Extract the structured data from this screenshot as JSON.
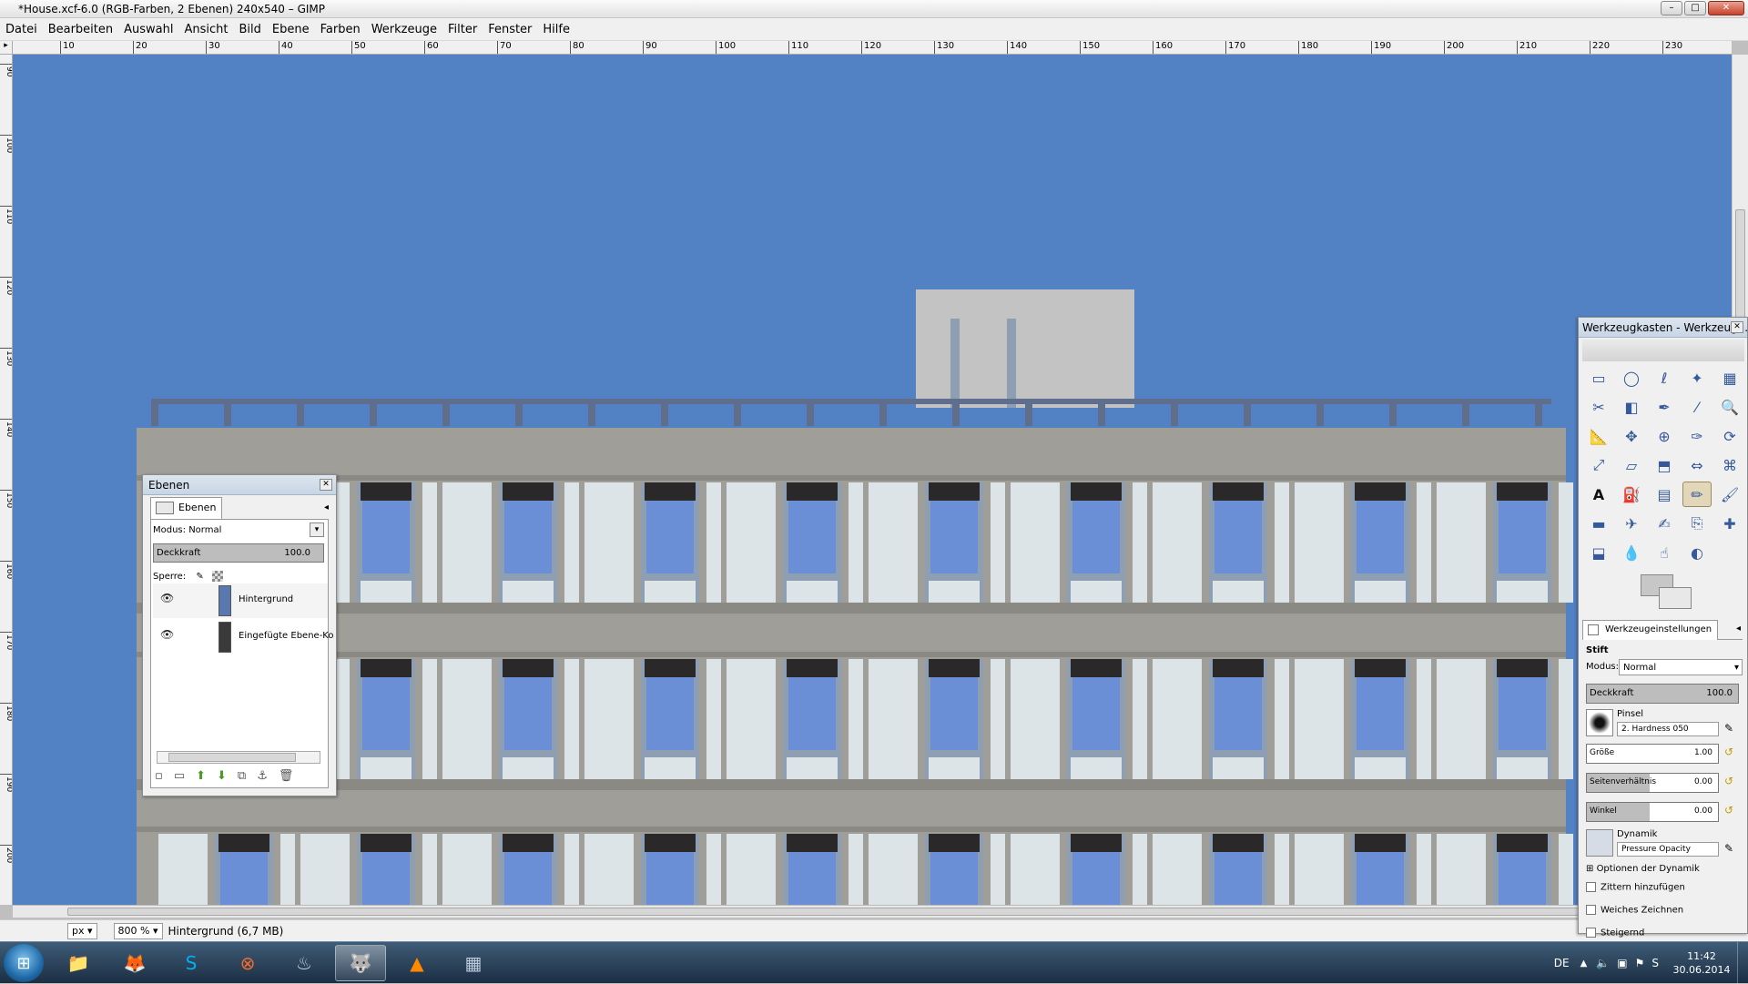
{
  "window": {
    "title": "*House.xcf-6.0 (RGB-Farben, 2 Ebenen) 240x540 – GIMP",
    "min": "–",
    "max": "□",
    "close": "✕"
  },
  "menu": [
    "Datei",
    "Bearbeiten",
    "Auswahl",
    "Ansicht",
    "Bild",
    "Ebene",
    "Farben",
    "Werkzeuge",
    "Filter",
    "Fenster",
    "Hilfe"
  ],
  "ruler": {
    "h": [
      "10",
      "20",
      "30",
      "40",
      "50",
      "60",
      "70",
      "80",
      "90",
      "100",
      "110",
      "120",
      "130",
      "140",
      "150",
      "160",
      "170",
      "180",
      "190",
      "200",
      "210",
      "220",
      "230"
    ],
    "v": [
      "90",
      "100",
      "110",
      "120",
      "130",
      "140",
      "150",
      "160",
      "170",
      "180",
      "190",
      "200"
    ]
  },
  "colors": {
    "sky": "#5282c4",
    "building": "#c3c3c3",
    "facade": "#a09e99",
    "window_glass": "#6b8fd6",
    "window_frame": "#8e9fb4",
    "panel": "#dde4e8",
    "railing": "#5f6e8c"
  },
  "status": {
    "unit": "px",
    "zoom": "800 %",
    "info": "Hintergrund (6,7 MB)"
  },
  "layers": {
    "title": "Ebenen",
    "tab": "Ebenen",
    "mode_label": "Modus:",
    "mode_value": "Normal",
    "opacity_label": "Deckkraft",
    "opacity_value": "100.0",
    "lock_label": "Sperre:",
    "items": [
      {
        "name": "Hintergrund"
      },
      {
        "name": "Eingefügte Ebene-Ko"
      }
    ]
  },
  "toolbox": {
    "title": "Werkzeugkasten - Werkzeug...",
    "tools": [
      "rect-select",
      "ellipse-select",
      "free-select",
      "fuzzy-select",
      "color-select",
      "scissors",
      "foreground-select",
      "paths",
      "color-picker",
      "zoom",
      "measure",
      "move",
      "align",
      "crop",
      "rotate",
      "scale",
      "shear",
      "perspective",
      "flip",
      "cage",
      "text",
      "bucket-fill",
      "blend",
      "pencil",
      "paintbrush",
      "eraser",
      "airbrush",
      "ink",
      "clone",
      "heal",
      "perspective-clone",
      "blur",
      "smudge",
      "dodge"
    ],
    "options_tab": "Werkzeugeinstellungen",
    "tool_name": "Stift",
    "mode_label": "Modus:",
    "mode_value": "Normal",
    "opacity_label": "Deckkraft",
    "opacity_value": "100.0",
    "brush_label": "Pinsel",
    "brush_value": "2. Hardness 050",
    "size_label": "Größe",
    "size_value": "1.00",
    "aspect_label": "Seitenverhältnis",
    "aspect_value": "0.00",
    "angle_label": "Winkel",
    "angle_value": "0.00",
    "dynamics_label": "Dynamik",
    "dynamics_value": "Pressure Opacity",
    "dyn_options": "Optionen der Dynamik",
    "jitter": "Zittern hinzufügen",
    "smooth": "Weiches Zeichnen",
    "incremental": "Steigernd"
  },
  "taskbar": {
    "apps": [
      {
        "icon": "explorer-icon"
      },
      {
        "icon": "firefox-icon"
      },
      {
        "icon": "skype-icon"
      },
      {
        "icon": "origin-icon"
      },
      {
        "icon": "steam-icon"
      },
      {
        "icon": "gimp-icon"
      },
      {
        "icon": "vlc-icon"
      },
      {
        "icon": "calculator-icon"
      }
    ],
    "lang": "DE",
    "time": "11:42",
    "date": "30.06.2014"
  }
}
